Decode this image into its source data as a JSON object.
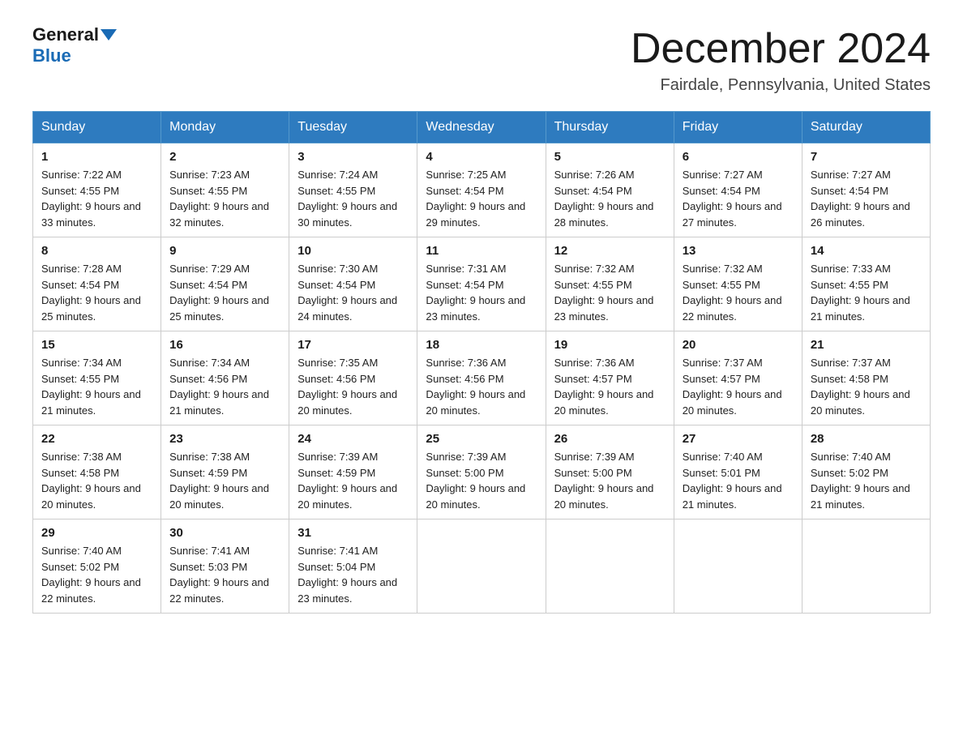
{
  "header": {
    "logo_general": "General",
    "logo_blue": "Blue",
    "month_title": "December 2024",
    "location": "Fairdale, Pennsylvania, United States"
  },
  "days_of_week": [
    "Sunday",
    "Monday",
    "Tuesday",
    "Wednesday",
    "Thursday",
    "Friday",
    "Saturday"
  ],
  "weeks": [
    [
      {
        "num": "1",
        "sunrise": "7:22 AM",
        "sunset": "4:55 PM",
        "daylight": "9 hours and 33 minutes."
      },
      {
        "num": "2",
        "sunrise": "7:23 AM",
        "sunset": "4:55 PM",
        "daylight": "9 hours and 32 minutes."
      },
      {
        "num": "3",
        "sunrise": "7:24 AM",
        "sunset": "4:55 PM",
        "daylight": "9 hours and 30 minutes."
      },
      {
        "num": "4",
        "sunrise": "7:25 AM",
        "sunset": "4:54 PM",
        "daylight": "9 hours and 29 minutes."
      },
      {
        "num": "5",
        "sunrise": "7:26 AM",
        "sunset": "4:54 PM",
        "daylight": "9 hours and 28 minutes."
      },
      {
        "num": "6",
        "sunrise": "7:27 AM",
        "sunset": "4:54 PM",
        "daylight": "9 hours and 27 minutes."
      },
      {
        "num": "7",
        "sunrise": "7:27 AM",
        "sunset": "4:54 PM",
        "daylight": "9 hours and 26 minutes."
      }
    ],
    [
      {
        "num": "8",
        "sunrise": "7:28 AM",
        "sunset": "4:54 PM",
        "daylight": "9 hours and 25 minutes."
      },
      {
        "num": "9",
        "sunrise": "7:29 AM",
        "sunset": "4:54 PM",
        "daylight": "9 hours and 25 minutes."
      },
      {
        "num": "10",
        "sunrise": "7:30 AM",
        "sunset": "4:54 PM",
        "daylight": "9 hours and 24 minutes."
      },
      {
        "num": "11",
        "sunrise": "7:31 AM",
        "sunset": "4:54 PM",
        "daylight": "9 hours and 23 minutes."
      },
      {
        "num": "12",
        "sunrise": "7:32 AM",
        "sunset": "4:55 PM",
        "daylight": "9 hours and 23 minutes."
      },
      {
        "num": "13",
        "sunrise": "7:32 AM",
        "sunset": "4:55 PM",
        "daylight": "9 hours and 22 minutes."
      },
      {
        "num": "14",
        "sunrise": "7:33 AM",
        "sunset": "4:55 PM",
        "daylight": "9 hours and 21 minutes."
      }
    ],
    [
      {
        "num": "15",
        "sunrise": "7:34 AM",
        "sunset": "4:55 PM",
        "daylight": "9 hours and 21 minutes."
      },
      {
        "num": "16",
        "sunrise": "7:34 AM",
        "sunset": "4:56 PM",
        "daylight": "9 hours and 21 minutes."
      },
      {
        "num": "17",
        "sunrise": "7:35 AM",
        "sunset": "4:56 PM",
        "daylight": "9 hours and 20 minutes."
      },
      {
        "num": "18",
        "sunrise": "7:36 AM",
        "sunset": "4:56 PM",
        "daylight": "9 hours and 20 minutes."
      },
      {
        "num": "19",
        "sunrise": "7:36 AM",
        "sunset": "4:57 PM",
        "daylight": "9 hours and 20 minutes."
      },
      {
        "num": "20",
        "sunrise": "7:37 AM",
        "sunset": "4:57 PM",
        "daylight": "9 hours and 20 minutes."
      },
      {
        "num": "21",
        "sunrise": "7:37 AM",
        "sunset": "4:58 PM",
        "daylight": "9 hours and 20 minutes."
      }
    ],
    [
      {
        "num": "22",
        "sunrise": "7:38 AM",
        "sunset": "4:58 PM",
        "daylight": "9 hours and 20 minutes."
      },
      {
        "num": "23",
        "sunrise": "7:38 AM",
        "sunset": "4:59 PM",
        "daylight": "9 hours and 20 minutes."
      },
      {
        "num": "24",
        "sunrise": "7:39 AM",
        "sunset": "4:59 PM",
        "daylight": "9 hours and 20 minutes."
      },
      {
        "num": "25",
        "sunrise": "7:39 AM",
        "sunset": "5:00 PM",
        "daylight": "9 hours and 20 minutes."
      },
      {
        "num": "26",
        "sunrise": "7:39 AM",
        "sunset": "5:00 PM",
        "daylight": "9 hours and 20 minutes."
      },
      {
        "num": "27",
        "sunrise": "7:40 AM",
        "sunset": "5:01 PM",
        "daylight": "9 hours and 21 minutes."
      },
      {
        "num": "28",
        "sunrise": "7:40 AM",
        "sunset": "5:02 PM",
        "daylight": "9 hours and 21 minutes."
      }
    ],
    [
      {
        "num": "29",
        "sunrise": "7:40 AM",
        "sunset": "5:02 PM",
        "daylight": "9 hours and 22 minutes."
      },
      {
        "num": "30",
        "sunrise": "7:41 AM",
        "sunset": "5:03 PM",
        "daylight": "9 hours and 22 minutes."
      },
      {
        "num": "31",
        "sunrise": "7:41 AM",
        "sunset": "5:04 PM",
        "daylight": "9 hours and 23 minutes."
      },
      null,
      null,
      null,
      null
    ]
  ]
}
